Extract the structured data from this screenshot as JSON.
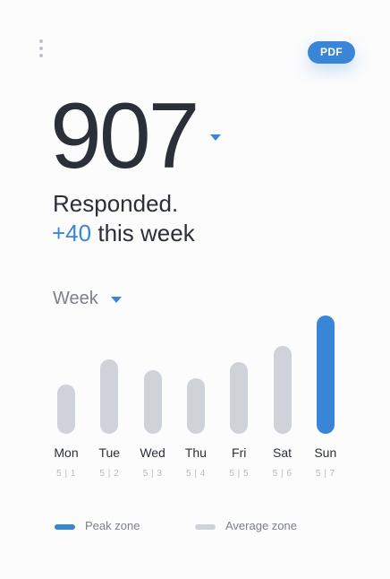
{
  "header": {
    "pdf_label": "PDF",
    "menu_icon": "more-vertical-icon"
  },
  "summary": {
    "total": "907",
    "status_text": "Responded.",
    "weekly_delta": "+40",
    "weekly_delta_suffix": "this week"
  },
  "period": {
    "selected": "Week"
  },
  "chart_data": {
    "type": "bar",
    "categories": [
      "Mon",
      "Tue",
      "Wed",
      "Thu",
      "Fri",
      "Sat",
      "Sun"
    ],
    "dates": [
      "5 | 1",
      "5 | 2",
      "5 | 3",
      "5 | 4",
      "5 | 5",
      "5 | 6",
      "5 | 7"
    ],
    "values": [
      55,
      84,
      72,
      62,
      81,
      99,
      133
    ],
    "peak_index": 6,
    "ylim": [
      0,
      133
    ],
    "grid": false,
    "legend": "bottom"
  },
  "legend": {
    "items": [
      {
        "label": "Peak zone",
        "color": "#3a86d6"
      },
      {
        "label": "Average zone",
        "color": "#cfd3d9"
      }
    ]
  },
  "colors": {
    "accent": "#3a86d6",
    "average": "#cfd3d9",
    "text": "#2b2f38",
    "muted": "#7b8089"
  }
}
